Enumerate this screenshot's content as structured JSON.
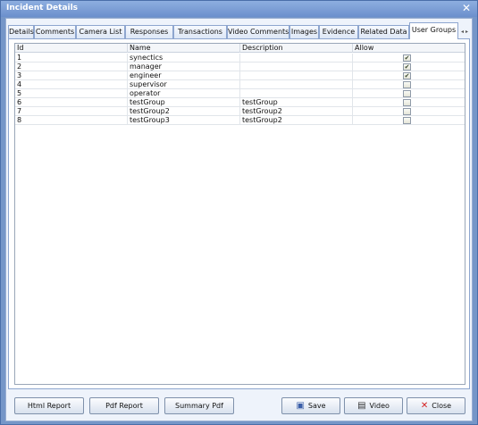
{
  "window": {
    "title": "Incident Details"
  },
  "tabs": [
    {
      "label": "Details"
    },
    {
      "label": "Comments"
    },
    {
      "label": "Camera List"
    },
    {
      "label": "Responses"
    },
    {
      "label": "Transactions"
    },
    {
      "label": "Video Comments"
    },
    {
      "label": "Images"
    },
    {
      "label": "Evidence"
    },
    {
      "label": "Related Data"
    },
    {
      "label": "User Groups",
      "active": true
    }
  ],
  "grid": {
    "columns": [
      "Id",
      "Name",
      "Description",
      "Allow"
    ],
    "rows": [
      {
        "id": "1",
        "name": "synectics",
        "description": "",
        "allow": true
      },
      {
        "id": "2",
        "name": "manager",
        "description": "",
        "allow": true
      },
      {
        "id": "3",
        "name": "engineer",
        "description": "",
        "allow": true
      },
      {
        "id": "4",
        "name": "supervisor",
        "description": "",
        "allow": false
      },
      {
        "id": "5",
        "name": "operator",
        "description": "",
        "allow": false
      },
      {
        "id": "6",
        "name": "testGroup",
        "description": "testGroup",
        "allow": false
      },
      {
        "id": "7",
        "name": "testGroup2",
        "description": "testGroup2",
        "allow": false
      },
      {
        "id": "8",
        "name": "testGroup3",
        "description": "testGroup2",
        "allow": false
      }
    ]
  },
  "buttons": {
    "html_report": "Html Report",
    "pdf_report": "Pdf Report",
    "summary_pdf": "Summary Pdf",
    "save": "Save",
    "video": "Video",
    "close": "Close"
  },
  "icons": {
    "window_close": "close-icon",
    "tab_scroll": "tab-scroll-arrows-icon",
    "save": "floppy-disk-icon",
    "video": "film-strip-icon",
    "close": "red-x-icon"
  },
  "colors": {
    "title_bar": "#6b8fcc",
    "close_icon": "#d42020"
  }
}
